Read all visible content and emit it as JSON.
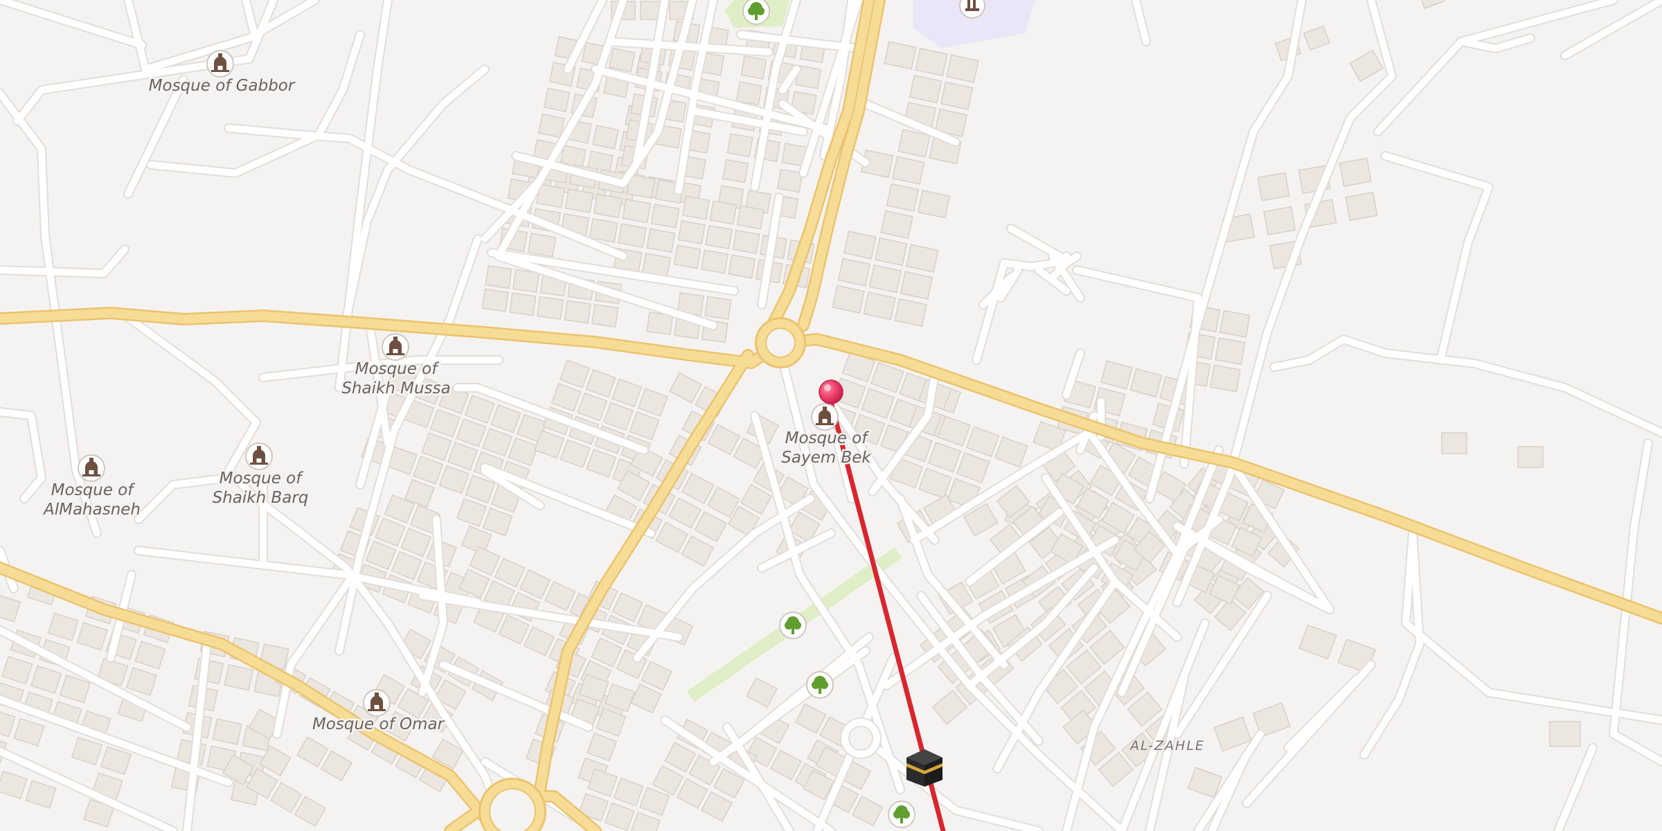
{
  "map": {
    "type": "street-map",
    "theme": "light",
    "colors": {
      "background": "#f5f3f1",
      "building": "#ece6e0",
      "building_edge": "#d8d0c8",
      "street": "#ffffff",
      "street_casing": "#e2ddd8",
      "main_road": "#f7dc96",
      "main_road_casing": "#ebc36e",
      "park": "#dfeec7",
      "qibla_line": "#d9262e",
      "location_pin": "#ef3f6a",
      "poi_icon_fill": "#ffffff",
      "poi_icon_color": "#7a5c48",
      "tree_icon_color": "#5f9e2f"
    }
  },
  "places": [
    {
      "name": "Mosque of Gabbor",
      "icon": "mosque-icon"
    },
    {
      "name_line1": "Mosque of",
      "name_line2": "Shaikh Mussa",
      "icon": "mosque-icon"
    },
    {
      "name_line1": "Mosque of",
      "name_line2": "AlMahasneh",
      "icon": "mosque-icon"
    },
    {
      "name_line1": "Mosque of",
      "name_line2": "Shaikh Barq",
      "icon": "mosque-icon"
    },
    {
      "name_line1": "Mosque of",
      "name_line2": "Sayem Bek",
      "icon": "mosque-icon"
    },
    {
      "name": "Mosque of Omar",
      "icon": "mosque-icon"
    }
  ],
  "districts": [
    {
      "name": "AL-ZAHLE"
    }
  ],
  "markers": {
    "current_location": {
      "icon": "location-pin-icon"
    },
    "qibla_direction": {
      "icon": "kaaba-icon"
    },
    "parks": [
      {
        "icon": "tree-icon"
      },
      {
        "icon": "tree-icon"
      },
      {
        "icon": "tree-icon"
      },
      {
        "icon": "tree-icon"
      }
    ],
    "landmark": {
      "icon": "landmark-icon"
    }
  }
}
